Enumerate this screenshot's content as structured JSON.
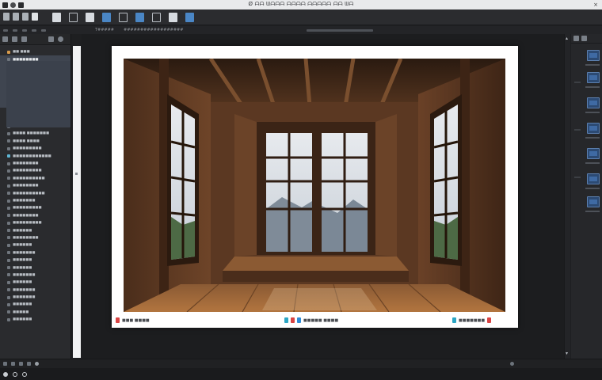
{
  "window": {
    "title": "Ø ᗩᗩ ᗯᗩᗩᗩ ᗩᗩᗩᗩ ᗩᗩᗩᗩᗩ ᗩᗩ ᗯᗩ",
    "close_glyph": "×"
  },
  "secondbar": {
    "label_a": "T#####",
    "label_b": "##################"
  },
  "left_panel": {
    "tab_label": "",
    "items": [
      {
        "label": "■■ ■■■",
        "kind": "folder"
      },
      {
        "label": "■■■■■■■■",
        "kind": "sel"
      },
      {
        "label": "■■ ■■ ■■■■ ■■■■",
        "kind": "sel"
      },
      {
        "label": "■■■■■■■■■■■■",
        "kind": "sel"
      },
      {
        "label": "■ ■■■■ ■■■■■■",
        "kind": "sel"
      },
      {
        "label": "■■ ■■■",
        "kind": "sel"
      },
      {
        "label": "■■■■ ■■ ■■■",
        "kind": "sel"
      },
      {
        "label": "■■■■■■■",
        "kind": "sel"
      },
      {
        "label": "■■■■ ■■ ■■■■",
        "kind": "plain"
      },
      {
        "label": "■■■■■■ ■■■■■■",
        "kind": "plain"
      },
      {
        "label": "■■■■■■■■■■■",
        "kind": "plain"
      },
      {
        "label": "■■■■ ■■■■■■■",
        "kind": "plain"
      },
      {
        "label": "■■■■ ■■■■",
        "kind": "plain"
      },
      {
        "label": "■■■■■■■■■",
        "kind": "plain"
      },
      {
        "label": "■■■■■■■■■■■■",
        "kind": "cyan"
      },
      {
        "label": "■■■■■■■■",
        "kind": "plain"
      },
      {
        "label": "■■■■■■■■■",
        "kind": "plain"
      },
      {
        "label": "■■■■■■■■■■",
        "kind": "plain"
      },
      {
        "label": "■■■■■■■■",
        "kind": "plain"
      },
      {
        "label": "■■■■■■■■■■",
        "kind": "plain"
      },
      {
        "label": "■■■■■■■",
        "kind": "plain"
      },
      {
        "label": "■■■■■■■■■",
        "kind": "plain"
      },
      {
        "label": "■■■■■■■■",
        "kind": "plain"
      },
      {
        "label": "■■■■■■■■■",
        "kind": "plain"
      },
      {
        "label": "■■■■■■",
        "kind": "plain"
      },
      {
        "label": "■■■■■■■■",
        "kind": "plain"
      },
      {
        "label": "■■■■■■",
        "kind": "plain"
      },
      {
        "label": "■■■■■■■",
        "kind": "plain"
      },
      {
        "label": "■■■■■■",
        "kind": "plain"
      },
      {
        "label": "■■■■■■",
        "kind": "plain"
      },
      {
        "label": "■■■■■■■",
        "kind": "plain"
      },
      {
        "label": "■■■■■■",
        "kind": "plain"
      },
      {
        "label": "■■■■■■■",
        "kind": "plain"
      },
      {
        "label": "■■■■■■■",
        "kind": "plain"
      },
      {
        "label": "■■■■■■",
        "kind": "plain"
      },
      {
        "label": "■■■■■",
        "kind": "plain"
      },
      {
        "label": "■■■■■■",
        "kind": "plain"
      }
    ]
  },
  "document": {
    "caption_left": "■■■ ■■■■",
    "caption_center": "■■■■■ ■■■■",
    "caption_right": "■■■■■■■"
  },
  "colors": {
    "caption_red": "#d94444",
    "caption_cyan": "#2ca6c4",
    "caption_blue": "#2e8bd6"
  },
  "icons": {
    "window_controls": [
      "app-icon",
      "menu-icon",
      "gear-icon"
    ],
    "toolbar": [
      "page-icon",
      "layout-icon",
      "frame-icon",
      "text-icon",
      "image-icon",
      "image-icon",
      "link-icon",
      "document-icon",
      "shape-icon"
    ]
  }
}
